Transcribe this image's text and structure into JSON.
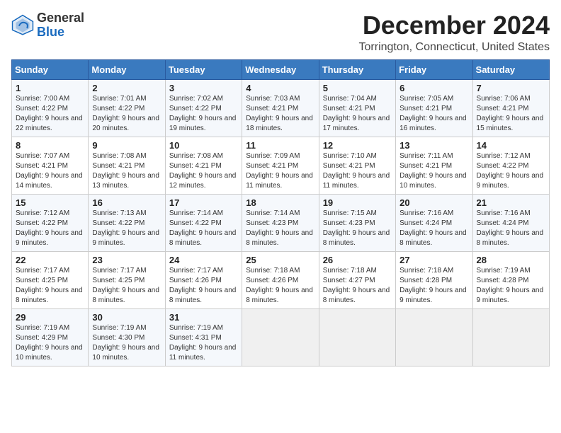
{
  "header": {
    "logo_line1": "General",
    "logo_line2": "Blue",
    "month": "December 2024",
    "location": "Torrington, Connecticut, United States"
  },
  "weekdays": [
    "Sunday",
    "Monday",
    "Tuesday",
    "Wednesday",
    "Thursday",
    "Friday",
    "Saturday"
  ],
  "weeks": [
    [
      {
        "day": "1",
        "sunrise": "7:00 AM",
        "sunset": "4:22 PM",
        "daylight": "9 hours and 22 minutes."
      },
      {
        "day": "2",
        "sunrise": "7:01 AM",
        "sunset": "4:22 PM",
        "daylight": "9 hours and 20 minutes."
      },
      {
        "day": "3",
        "sunrise": "7:02 AM",
        "sunset": "4:22 PM",
        "daylight": "9 hours and 19 minutes."
      },
      {
        "day": "4",
        "sunrise": "7:03 AM",
        "sunset": "4:21 PM",
        "daylight": "9 hours and 18 minutes."
      },
      {
        "day": "5",
        "sunrise": "7:04 AM",
        "sunset": "4:21 PM",
        "daylight": "9 hours and 17 minutes."
      },
      {
        "day": "6",
        "sunrise": "7:05 AM",
        "sunset": "4:21 PM",
        "daylight": "9 hours and 16 minutes."
      },
      {
        "day": "7",
        "sunrise": "7:06 AM",
        "sunset": "4:21 PM",
        "daylight": "9 hours and 15 minutes."
      }
    ],
    [
      {
        "day": "8",
        "sunrise": "7:07 AM",
        "sunset": "4:21 PM",
        "daylight": "9 hours and 14 minutes."
      },
      {
        "day": "9",
        "sunrise": "7:08 AM",
        "sunset": "4:21 PM",
        "daylight": "9 hours and 13 minutes."
      },
      {
        "day": "10",
        "sunrise": "7:08 AM",
        "sunset": "4:21 PM",
        "daylight": "9 hours and 12 minutes."
      },
      {
        "day": "11",
        "sunrise": "7:09 AM",
        "sunset": "4:21 PM",
        "daylight": "9 hours and 11 minutes."
      },
      {
        "day": "12",
        "sunrise": "7:10 AM",
        "sunset": "4:21 PM",
        "daylight": "9 hours and 11 minutes."
      },
      {
        "day": "13",
        "sunrise": "7:11 AM",
        "sunset": "4:21 PM",
        "daylight": "9 hours and 10 minutes."
      },
      {
        "day": "14",
        "sunrise": "7:12 AM",
        "sunset": "4:22 PM",
        "daylight": "9 hours and 9 minutes."
      }
    ],
    [
      {
        "day": "15",
        "sunrise": "7:12 AM",
        "sunset": "4:22 PM",
        "daylight": "9 hours and 9 minutes."
      },
      {
        "day": "16",
        "sunrise": "7:13 AM",
        "sunset": "4:22 PM",
        "daylight": "9 hours and 9 minutes."
      },
      {
        "day": "17",
        "sunrise": "7:14 AM",
        "sunset": "4:22 PM",
        "daylight": "9 hours and 8 minutes."
      },
      {
        "day": "18",
        "sunrise": "7:14 AM",
        "sunset": "4:23 PM",
        "daylight": "9 hours and 8 minutes."
      },
      {
        "day": "19",
        "sunrise": "7:15 AM",
        "sunset": "4:23 PM",
        "daylight": "9 hours and 8 minutes."
      },
      {
        "day": "20",
        "sunrise": "7:16 AM",
        "sunset": "4:24 PM",
        "daylight": "9 hours and 8 minutes."
      },
      {
        "day": "21",
        "sunrise": "7:16 AM",
        "sunset": "4:24 PM",
        "daylight": "9 hours and 8 minutes."
      }
    ],
    [
      {
        "day": "22",
        "sunrise": "7:17 AM",
        "sunset": "4:25 PM",
        "daylight": "9 hours and 8 minutes."
      },
      {
        "day": "23",
        "sunrise": "7:17 AM",
        "sunset": "4:25 PM",
        "daylight": "9 hours and 8 minutes."
      },
      {
        "day": "24",
        "sunrise": "7:17 AM",
        "sunset": "4:26 PM",
        "daylight": "9 hours and 8 minutes."
      },
      {
        "day": "25",
        "sunrise": "7:18 AM",
        "sunset": "4:26 PM",
        "daylight": "9 hours and 8 minutes."
      },
      {
        "day": "26",
        "sunrise": "7:18 AM",
        "sunset": "4:27 PM",
        "daylight": "9 hours and 8 minutes."
      },
      {
        "day": "27",
        "sunrise": "7:18 AM",
        "sunset": "4:28 PM",
        "daylight": "9 hours and 9 minutes."
      },
      {
        "day": "28",
        "sunrise": "7:19 AM",
        "sunset": "4:28 PM",
        "daylight": "9 hours and 9 minutes."
      }
    ],
    [
      {
        "day": "29",
        "sunrise": "7:19 AM",
        "sunset": "4:29 PM",
        "daylight": "9 hours and 10 minutes."
      },
      {
        "day": "30",
        "sunrise": "7:19 AM",
        "sunset": "4:30 PM",
        "daylight": "9 hours and 10 minutes."
      },
      {
        "day": "31",
        "sunrise": "7:19 AM",
        "sunset": "4:31 PM",
        "daylight": "9 hours and 11 minutes."
      },
      null,
      null,
      null,
      null
    ]
  ]
}
